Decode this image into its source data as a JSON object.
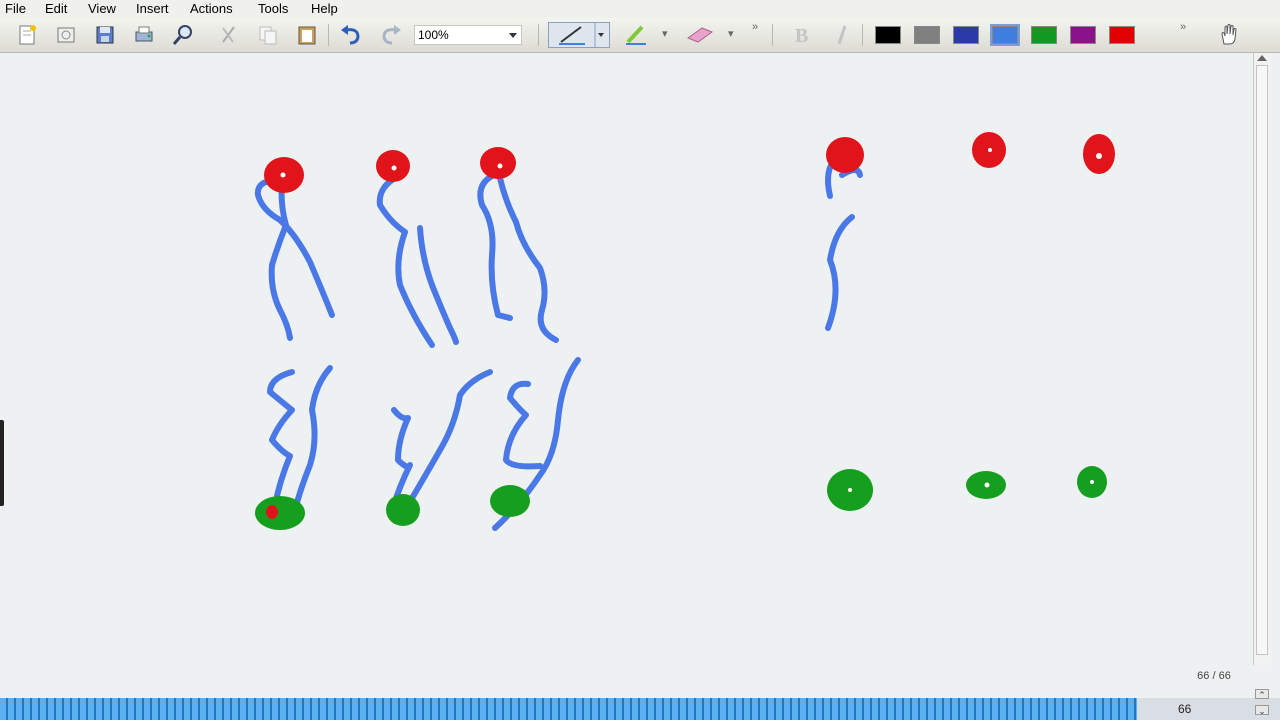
{
  "menu": {
    "file": "File",
    "edit": "Edit",
    "view": "View",
    "insert": "Insert",
    "actions": "Actions",
    "tools": "Tools",
    "help": "Help"
  },
  "toolbar": {
    "icons": [
      "new-page-icon",
      "open-icon",
      "save-icon",
      "print-icon",
      "search-icon",
      "cut-icon",
      "copy-icon",
      "paste-icon",
      "undo-icon",
      "redo-icon"
    ],
    "zoom": "100%",
    "tools": [
      "pen-icon",
      "highlighter-icon",
      "eraser-icon",
      "bold-icon",
      "italic-icon",
      "hand-icon"
    ],
    "colors": [
      "#000000",
      "#808080",
      "#2b3aa8",
      "#3f7fe0",
      "#119922",
      "#8a128a",
      "#e00000"
    ],
    "selected_color": "#3f7fe0"
  },
  "canvas": {
    "ink_colors": {
      "red": "#e0141a",
      "blue": "#4a78e6",
      "green": "#169f1f"
    }
  },
  "page_indicator": "66 / 66",
  "status": {
    "page_number": "66"
  }
}
